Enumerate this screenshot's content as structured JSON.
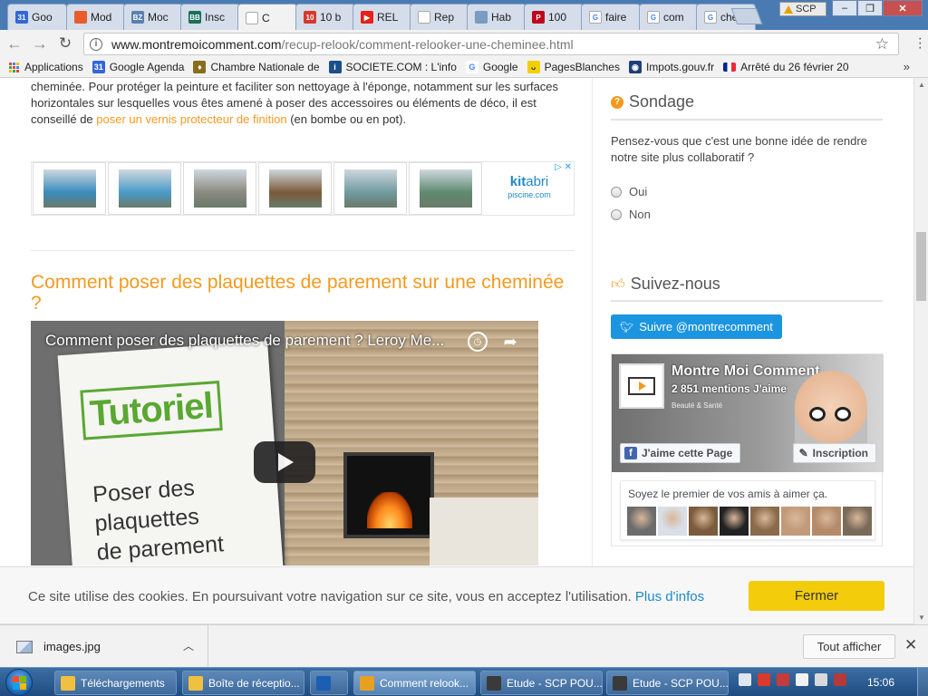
{
  "browser": {
    "tabs": [
      {
        "label": "Goo",
        "favicon_color": "#3367d6",
        "favicon_text": "31"
      },
      {
        "label": "Mod",
        "favicon_color": "#e85c2c",
        "favicon_text": ""
      },
      {
        "label": "Moc",
        "favicon_color": "#5b7fb0",
        "favicon_text": "BZ"
      },
      {
        "label": "Insc",
        "favicon_color": "#1a6e5a",
        "favicon_text": "BB"
      },
      {
        "label": "C",
        "favicon_color": "#ffffff",
        "favicon_text": ""
      },
      {
        "label": "10 b",
        "favicon_color": "#d8382c",
        "favicon_text": "10"
      },
      {
        "label": "REL",
        "favicon_color": "#e62117",
        "favicon_text": "▶"
      },
      {
        "label": "Rep",
        "favicon_color": "#ffffff",
        "favicon_text": ""
      },
      {
        "label": "Hab",
        "favicon_color": "#7a9cc3",
        "favicon_text": ""
      },
      {
        "label": "100",
        "favicon_color": "#bd081c",
        "favicon_text": "P"
      },
      {
        "label": "faire",
        "favicon_color": "#ffffff",
        "favicon_text": "G"
      },
      {
        "label": "com",
        "favicon_color": "#ffffff",
        "favicon_text": "G"
      },
      {
        "label": "che",
        "favicon_color": "#ffffff",
        "favicon_text": "G"
      }
    ],
    "profile_badge": "SCP",
    "window_buttons": {
      "minimize": "–",
      "maximize": "❐",
      "close": "✕"
    },
    "url_host": "www.montremoicomment.com",
    "url_path": "/recup-relook/comment-relooker-une-cheminee.html",
    "bookmarks": [
      {
        "label": "Applications",
        "icon": "apps-grid-icon"
      },
      {
        "label": "Google Agenda",
        "icon": "calendar-icon",
        "color": "#3367d6",
        "glyph": "31"
      },
      {
        "label": "Chambre Nationale de",
        "icon": "chambre-icon",
        "color": "#8a6d1c",
        "glyph": "♦"
      },
      {
        "label": "SOCIETE.COM : L'info",
        "icon": "info-icon",
        "color": "#1a4f8a",
        "glyph": "i"
      },
      {
        "label": "Google",
        "icon": "google-icon",
        "color": "#ffffff",
        "glyph": "G"
      },
      {
        "label": "PagesBlanches",
        "icon": "pagesblanches-icon",
        "color": "#f2d000",
        "glyph": "ᴗ"
      },
      {
        "label": "Impots.gouv.fr",
        "icon": "impots-icon",
        "color": "#1f3f7a",
        "glyph": "◉"
      },
      {
        "label": "Arrêté du 26 février 20",
        "icon": "french-flag-icon",
        "color": "#002395",
        "glyph": ""
      }
    ],
    "bookmarks_more": "»"
  },
  "article": {
    "intro_text": "cheminée. Pour protéger la peinture et faciliter son nettoyage à l'éponge, notamment sur les surfaces horizontales sur lesquelles vous êtes amené à poser des accessoires ou éléments de déco, il est conseillé de ",
    "intro_link": "poser un vernis protecteur de finition",
    "intro_after": " (en bombe ou en pot).",
    "ad": {
      "thumb_colors": [
        "#3a8bbf",
        "#4a9ac8",
        "#8a8a80",
        "#7a5a3a",
        "#6f9a9f",
        "#5f8a70"
      ],
      "logo_kit": "kit",
      "logo_abri": "abri",
      "logo_sub": "piscine.com",
      "adchoices": "▷ ✕"
    },
    "heading": "Comment poser des plaquettes de parement sur une cheminée ?",
    "video": {
      "title": "Comment poser des plaquettes de parement ? Leroy Me...",
      "paper_tag": "Tutoriel",
      "paper_text_lines": [
        "Poser des",
        "plaquettes",
        "de parement"
      ]
    }
  },
  "sidebar": {
    "poll": {
      "title": "Sondage",
      "question": "Pensez-vous que c'est une bonne idée de rendre notre site plus collaboratif ?",
      "options": [
        "Oui",
        "Non"
      ]
    },
    "follow": {
      "title": "Suivez-nous",
      "twitter_button": "Suivre @montrecomment",
      "facebook": {
        "page_name": "Montre Moi Comment",
        "likes": "2 851 mentions J'aime",
        "cover_tags": "Beauté & Santé",
        "like_button": "J'aime cette Page",
        "signup_button": "Inscription",
        "friends_text": "Soyez le premier de vos amis à aimer ça.",
        "face_colors": [
          "#6c6c6c",
          "#d9dfe8",
          "#7b5b3b",
          "#222222",
          "#8a6a4a",
          "#c29a7a",
          "#b58a6a",
          "#7a6a5a"
        ]
      }
    }
  },
  "cookie": {
    "text": "Ce site utilise des cookies. En poursuivant votre navigation sur ce site, vous en acceptez l'utilisation.",
    "link": "Plus d'infos",
    "button": "Fermer"
  },
  "downloads": {
    "file": "images.jpg",
    "show_all": "Tout afficher",
    "close": "✕"
  },
  "taskbar": {
    "items": [
      {
        "label": "Téléchargements",
        "color": "#f0c040"
      },
      {
        "label": "Boîte de réceptio...",
        "color": "#f0c040"
      },
      {
        "label": "",
        "color": "#1a5fb4"
      },
      {
        "label": "Comment relook...",
        "color": "#e8a020"
      },
      {
        "label": "Etude - SCP POU...",
        "color": "#3a3a3a"
      },
      {
        "label": "Etude - SCP POU...",
        "color": "#3a3a3a"
      }
    ],
    "clock": "15:06"
  }
}
